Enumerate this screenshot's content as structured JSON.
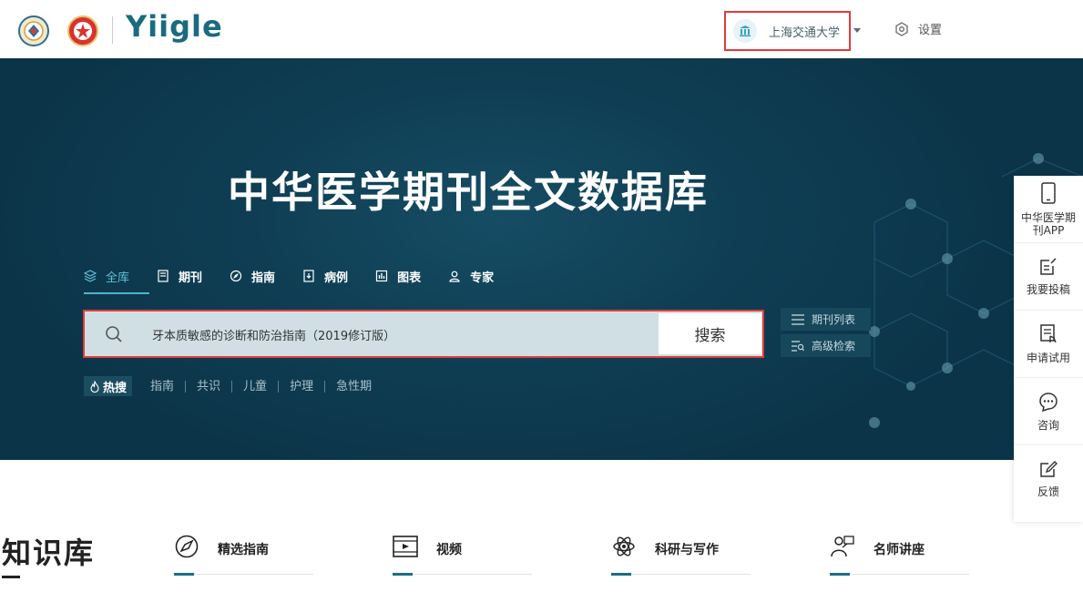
{
  "header": {
    "brand": "Yiigle",
    "institution": "上海交通大学",
    "settings_label": "设置"
  },
  "hero": {
    "title": "中华医学期刊全文数据库",
    "tabs": [
      {
        "label": "全库",
        "icon": "layers-icon",
        "active": true
      },
      {
        "label": "期刊",
        "icon": "journal-icon"
      },
      {
        "label": "指南",
        "icon": "compass-icon"
      },
      {
        "label": "病例",
        "icon": "case-icon"
      },
      {
        "label": "图表",
        "icon": "chart-icon"
      },
      {
        "label": "专家",
        "icon": "expert-icon"
      }
    ],
    "search": {
      "value": "牙本质敏感的诊断和防治指南（2019修订版）",
      "button": "搜索"
    },
    "side_links": [
      {
        "label": "期刊列表",
        "icon": "list-icon"
      },
      {
        "label": "高级检索",
        "icon": "advanced-search-icon"
      }
    ],
    "hot": {
      "label": "热搜",
      "items": [
        "指南",
        "共识",
        "儿童",
        "护理",
        "急性期"
      ]
    }
  },
  "knowledge": {
    "title": "知识库",
    "categories": [
      {
        "label": "精选指南",
        "icon": "compass-icon"
      },
      {
        "label": "视频",
        "icon": "video-icon"
      },
      {
        "label": "科研与写作",
        "icon": "atom-icon"
      },
      {
        "label": "名师讲座",
        "icon": "lecturer-icon"
      }
    ]
  },
  "rail": [
    {
      "label": "中华医学期刊APP",
      "icon": "phone-icon"
    },
    {
      "label": "我要投稿",
      "icon": "edit-doc-icon"
    },
    {
      "label": "申请试用",
      "icon": "apply-icon"
    },
    {
      "label": "咨询",
      "icon": "chat-icon"
    },
    {
      "label": "反馈",
      "icon": "feedback-icon"
    }
  ],
  "colors": {
    "accent": "#1c6e83",
    "hero_bg": "#0f3f55",
    "highlight": "#e03c3c",
    "active_tab": "#5fc3d9"
  }
}
